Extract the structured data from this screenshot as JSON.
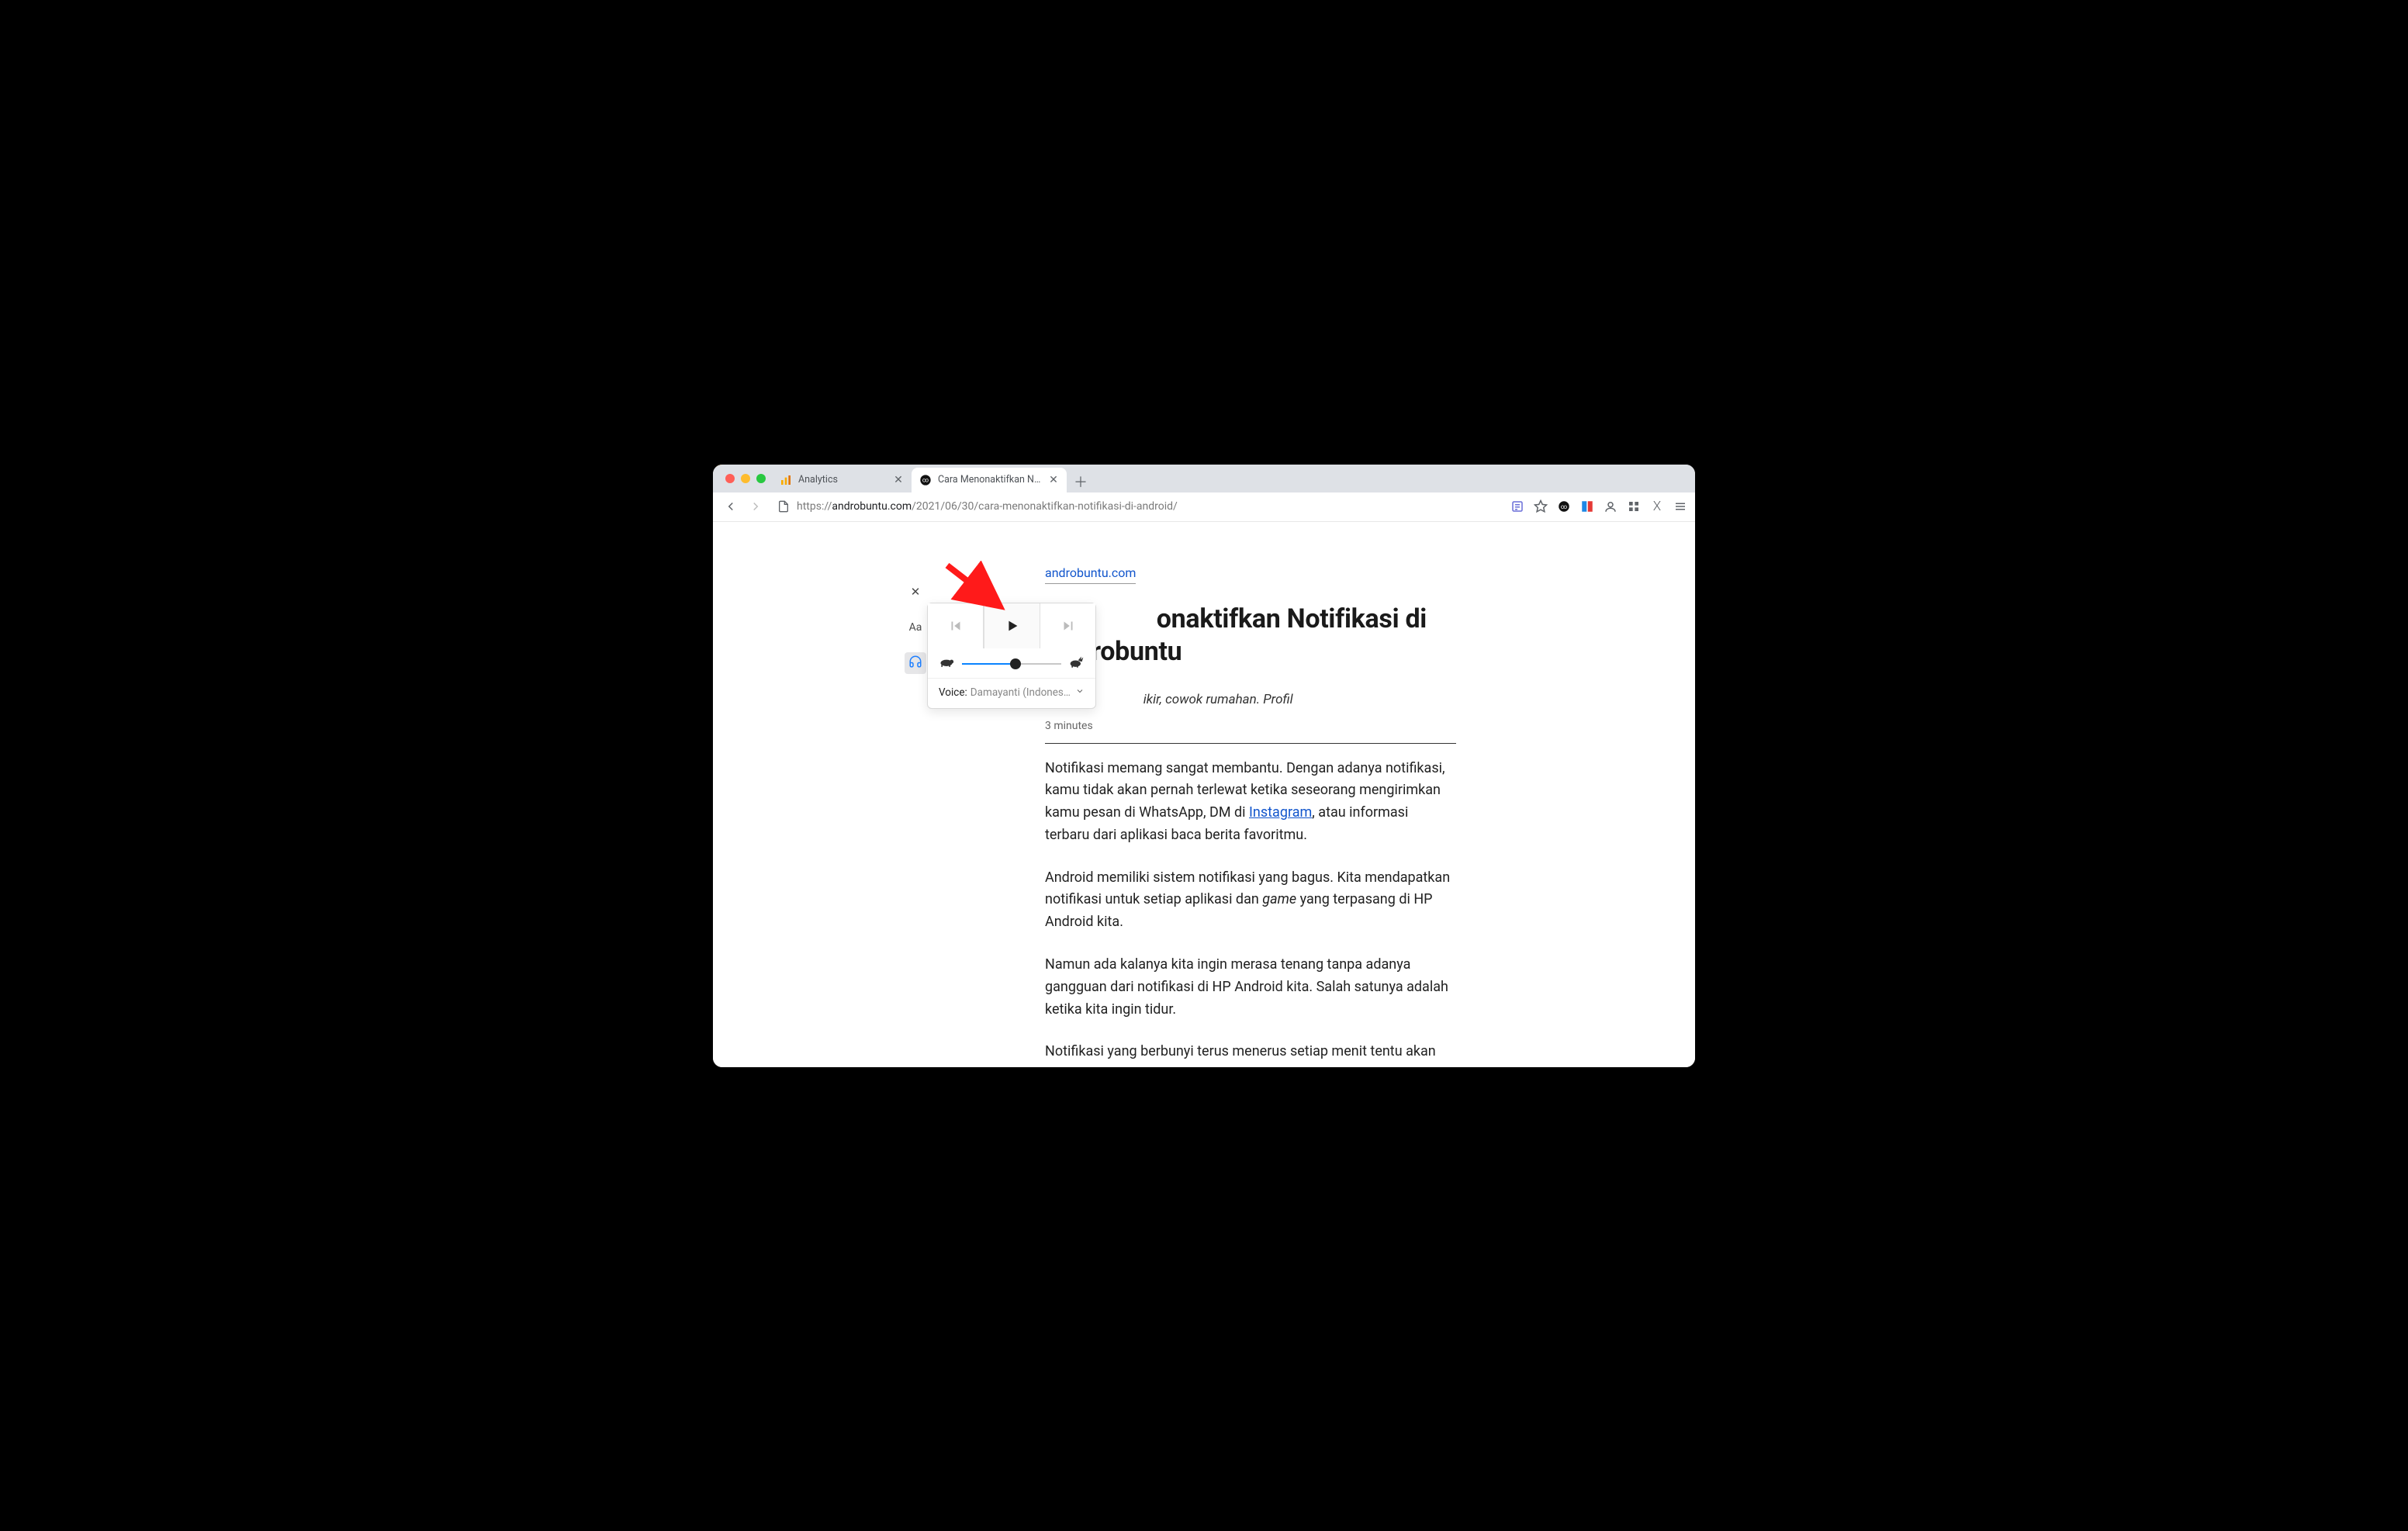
{
  "tabs": [
    {
      "title": "Analytics",
      "active": false
    },
    {
      "title": "Cara Menonaktifkan Notifikasi d",
      "active": true
    }
  ],
  "url": {
    "muted_prefix": "https://",
    "host": "androbuntu.com",
    "muted_suffix": "/2021/06/30/cara-menonaktifkan-notifikasi-di-android/"
  },
  "reader": {
    "close_glyph": "✕",
    "type_glyph": "Aa"
  },
  "narrate": {
    "voice_label": "Voice:",
    "voice_value": "Damayanti (Indonesian)",
    "speed_percent": 54
  },
  "article": {
    "site": "androbuntu.com",
    "title_full": "Cara Menonaktifkan Notifikasi di Android - Androbuntu",
    "title_visible": "onaktifkan Notifikasi di Androbuntu",
    "byline_visible": "ikir, cowok rumahan. Profil",
    "read_time": "3 minutes",
    "p1_a": "Notifikasi memang sangat membantu. Dengan adanya notifikasi, kamu tidak akan pernah terlewat ketika seseorang mengirimkan kamu pesan di WhatsApp, DM di ",
    "p1_link": "Instagram",
    "p1_b": ", atau informasi terbaru dari aplikasi baca berita favoritmu.",
    "p2_a": "Android memiliki sistem notifikasi yang bagus. Kita mendapatkan notifikasi untuk setiap aplikasi dan ",
    "p2_em": "game",
    "p2_b": " yang terpasang di HP Android kita.",
    "p3": "Namun ada kalanya kita ingin merasa tenang tanpa adanya gangguan dari notifikasi di HP Android kita. Salah satunya adalah ketika kita ingin tidur.",
    "p4": "Notifikasi yang berbunyi terus menerus setiap menit tentu akan mengganggu kita. Namun untungnya setiap aplikasi di Android"
  }
}
